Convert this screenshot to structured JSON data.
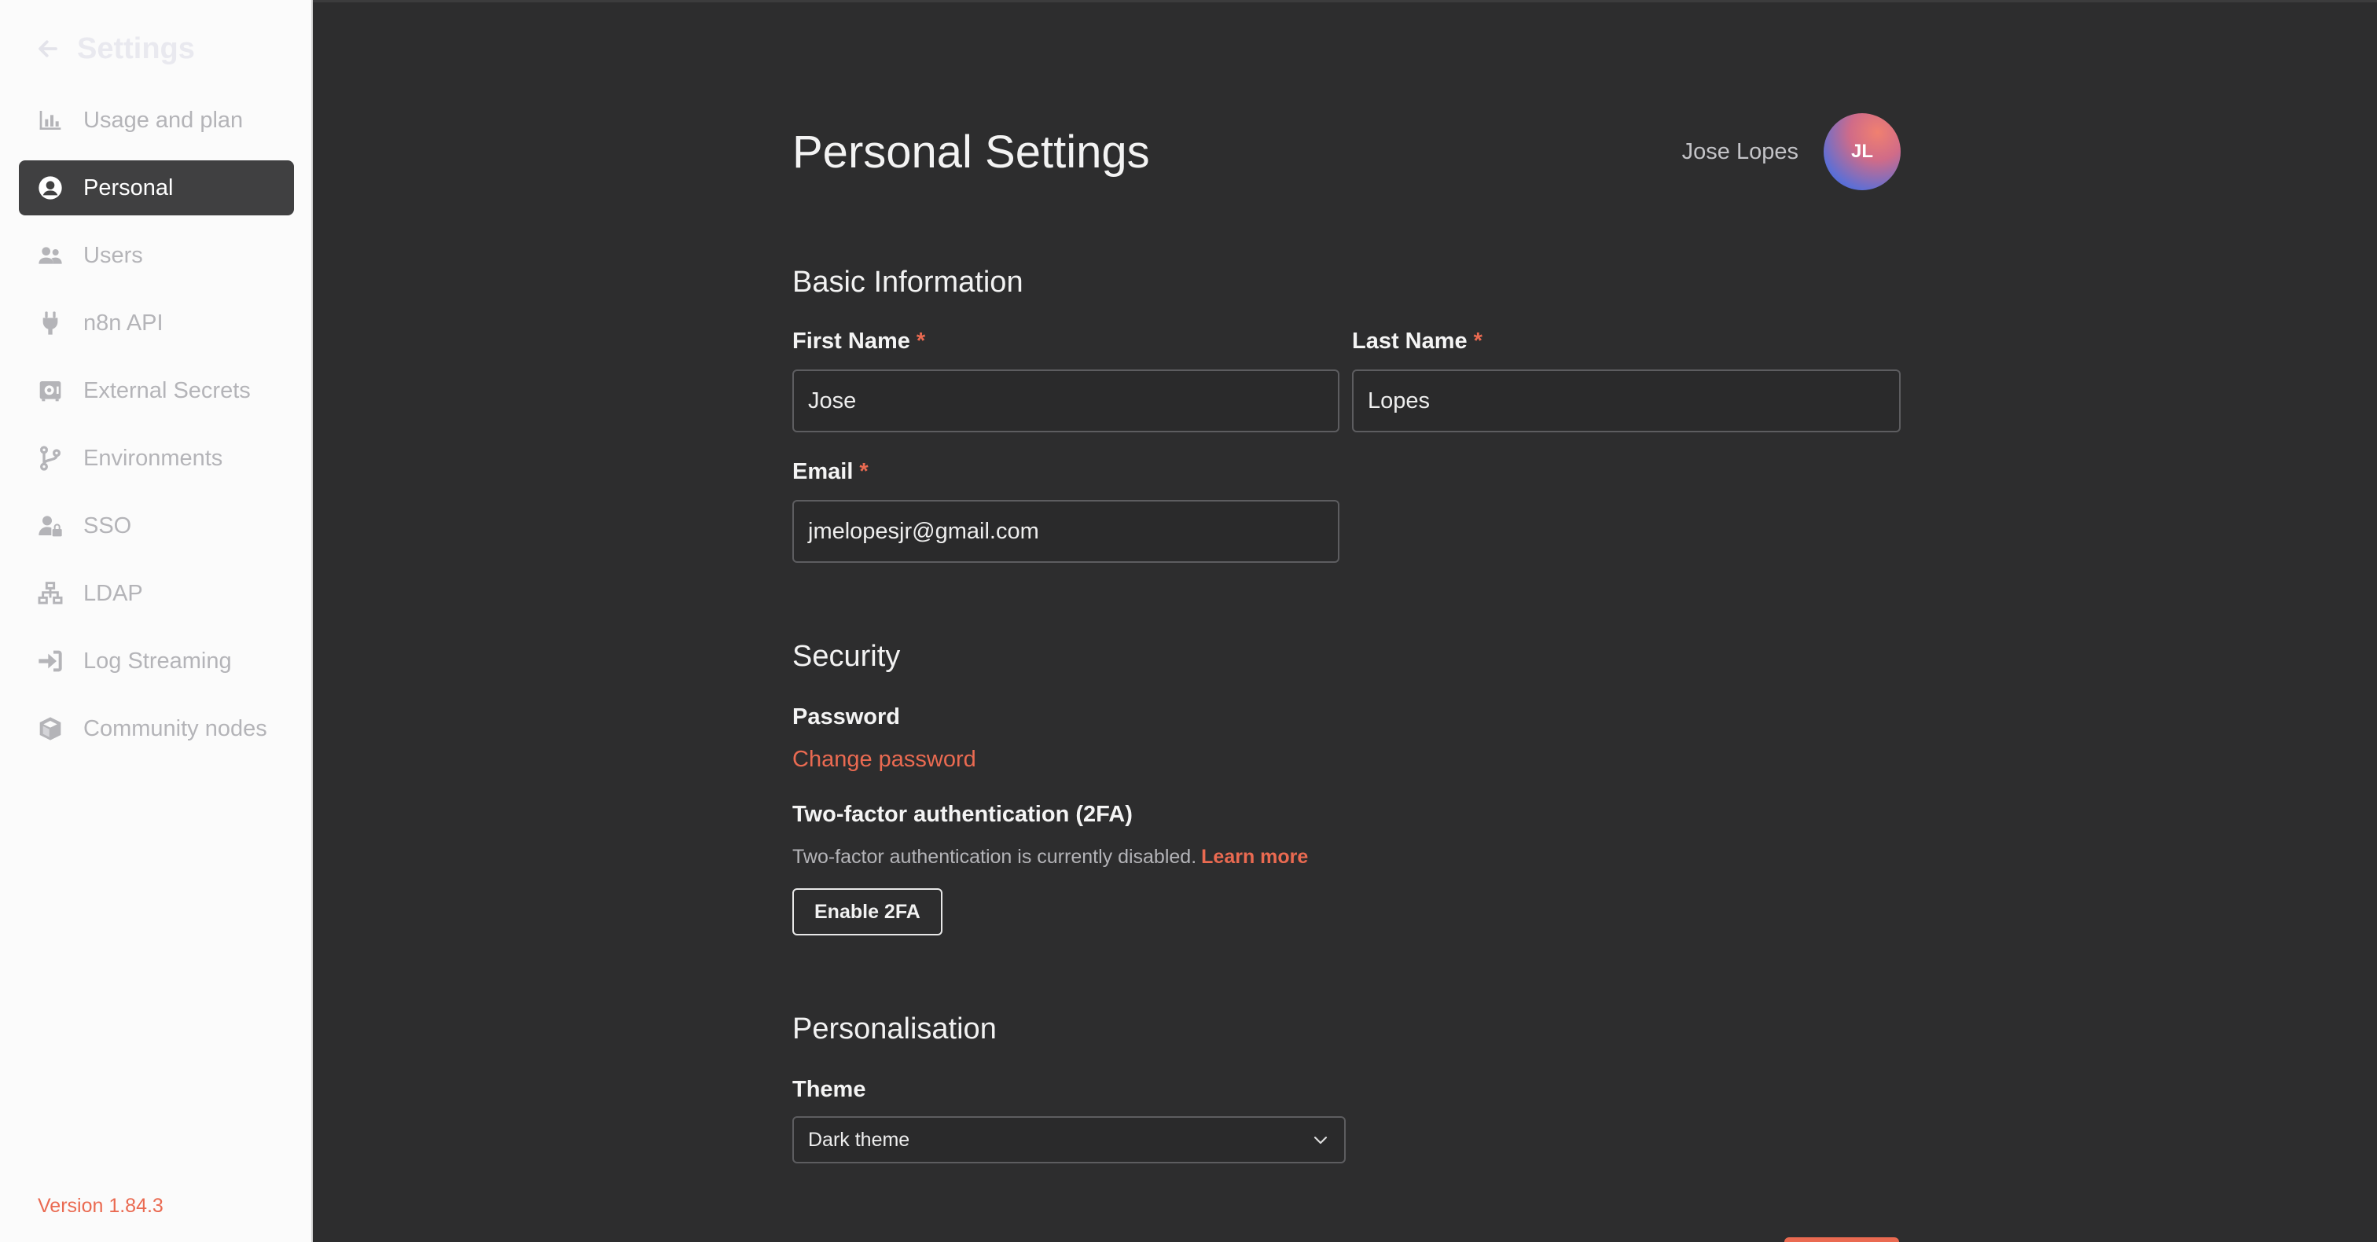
{
  "sidebar": {
    "header": "Settings",
    "items": [
      {
        "label": "Usage and plan",
        "icon": "chart-bar-icon"
      },
      {
        "label": "Personal",
        "icon": "user-circle-icon",
        "active": true
      },
      {
        "label": "Users",
        "icon": "users-icon"
      },
      {
        "label": "n8n API",
        "icon": "plug-icon"
      },
      {
        "label": "External Secrets",
        "icon": "vault-icon"
      },
      {
        "label": "Environments",
        "icon": "code-branch-icon"
      },
      {
        "label": "SSO",
        "icon": "user-lock-icon"
      },
      {
        "label": "LDAP",
        "icon": "network-icon"
      },
      {
        "label": "Log Streaming",
        "icon": "sign-in-icon"
      },
      {
        "label": "Community nodes",
        "icon": "cube-icon"
      }
    ],
    "version": "Version 1.84.3"
  },
  "main": {
    "title": "Personal Settings",
    "user": {
      "name": "Jose Lopes",
      "initials": "JL"
    },
    "basic": {
      "title": "Basic Information",
      "first_name_label": "First Name",
      "first_name_value": "Jose",
      "last_name_label": "Last Name",
      "last_name_value": "Lopes",
      "email_label": "Email",
      "email_value": "jmelopesjr@gmail.com",
      "required_mark": "*"
    },
    "security": {
      "title": "Security",
      "password_label": "Password",
      "change_password": "Change password",
      "twofa_label": "Two-factor authentication (2FA)",
      "twofa_desc": "Two-factor authentication is currently disabled.",
      "learn_more": "Learn more",
      "enable_button": "Enable 2FA"
    },
    "personalisation": {
      "title": "Personalisation",
      "theme_label": "Theme",
      "theme_value": "Dark theme"
    }
  },
  "colors": {
    "accent": "#ea6a51",
    "background": "#2d2d2e",
    "sidebar": "#fbfbfb",
    "active_item": "#404041"
  }
}
